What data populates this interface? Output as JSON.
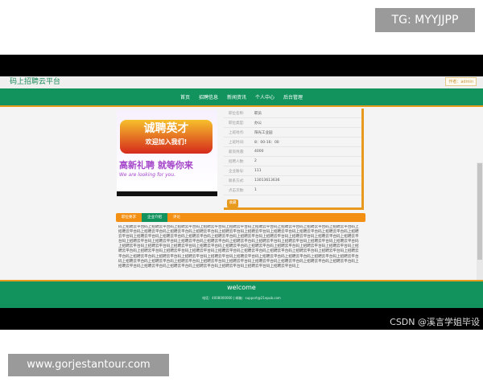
{
  "overlay": {
    "tg": "TG: MYYJJPP",
    "csdn": "CSDN @溪言学姐毕设",
    "watermark": "www.gorjestantour.com"
  },
  "header": {
    "title": "码上招聘云平台",
    "user": "作者：admin"
  },
  "nav": [
    "首页",
    "招聘信息",
    "新闻资讯",
    "个人中心",
    "后台管理"
  ],
  "banner": {
    "main": "诚聘英才",
    "sub": "欢迎加入我们!",
    "cn": "高新礼聘  就等你来",
    "en": "We are looking for you."
  },
  "info": [
    {
      "k": "职位名称:",
      "v": "职员"
    },
    {
      "k": "职位类型:",
      "v": "办公"
    },
    {
      "k": "上班地点:",
      "v": "阳光工业园"
    },
    {
      "k": "上班时间:",
      "v": "8：00-16：00"
    },
    {
      "k": "薪资待遇:",
      "v": "4000"
    },
    {
      "k": "招聘人数:",
      "v": "2"
    },
    {
      "k": "企业账号:",
      "v": "111"
    },
    {
      "k": "联系方式:",
      "v": "13013613636"
    },
    {
      "k": "点击次数:",
      "v": "1"
    }
  ],
  "collect_button": "收藏",
  "tabs": [
    "职位要求",
    "企业介绍",
    "评论"
  ],
  "content": "码上招聘云平台码上招聘云平台码上招聘云平台码上招聘云平台码上招聘云平台码上招聘云平台码上招聘云平台码上招聘云平台码上招聘云平台码上招聘云平台码上招聘云平台码上招聘云平台码上招聘云平台码上招聘云平台码上招聘云平台码上招聘云平台码上招聘云平台码上招聘云平台码上招聘云平台码上招聘云平台码上招聘云平台码上招聘云平台码上招聘云平台码上招聘云平台码上招聘云平台码上招聘云平台码上招聘云平台码上招聘云平台码上招聘云平台码上招聘云平台码上招聘云平台码上招聘云平台码上招聘云平台码上招聘云平台码上招聘云平台码上招聘云平台码上招聘云平台码上招聘云平台码上招聘云平台码上招聘云平台码上招聘云平台码上招聘云平台码上招聘云平台码上招聘云平台码上招聘云平台码上招聘云平台码上招聘云平台码上招聘云平台码上招聘云平台码上招聘云平台码上招聘云平台码上招聘云平台码上招聘云平台码上招聘云平台码上招聘云平台码上招聘云平台码上招聘云平台码上招聘云平台码上招聘云平台码上招聘云平台码上招聘云平台码上招聘云平台码上招聘云平台码上招聘云平台码上招聘云平台码上招聘云平台码上招聘云平台码上招聘云平台码上招聘云平台码上招聘云平台码上招聘云平台码上招聘云平台码上招聘云平台码上招聘云平台码上招聘云平台码上招聘云平台码上招聘云平台码上招聘云平台码上招聘云平台码上招聘云平台码上招聘云平台码上",
  "footer": {
    "welcome": "welcome",
    "contact": "电话：4008000000 | 邮箱：support@21epub.com"
  }
}
